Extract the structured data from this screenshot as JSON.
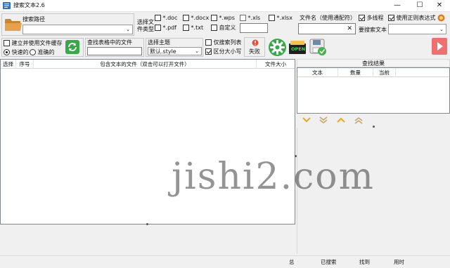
{
  "window": {
    "title": "搜索文本2.6",
    "controls": [
      "—",
      "☐",
      "✕"
    ]
  },
  "search_path": {
    "label": "搜索路径",
    "value": ""
  },
  "file_types": {
    "label_line1": "选择文",
    "label_line2": "件类型",
    "items": [
      {
        "label": "*.doc",
        "checked": false
      },
      {
        "label": "*.docx",
        "checked": false
      },
      {
        "label": "*.wps",
        "checked": false
      },
      {
        "label": "*.xls",
        "checked": false
      },
      {
        "label": "*.xlsx",
        "checked": false
      },
      {
        "label": "*.pdf",
        "checked": false
      },
      {
        "label": "*.txt",
        "checked": false
      },
      {
        "label": "自定义",
        "checked": false
      }
    ],
    "custom_value": ""
  },
  "file_name": {
    "label": "文件名（使用通配符）",
    "value": "",
    "clear_glyph": "✕"
  },
  "options": {
    "multithread": {
      "label": "多线程",
      "checked": true
    },
    "regex": {
      "label": "使用正则表达式",
      "checked": true
    },
    "search_text_label": "要搜索文本",
    "search_text_value": ""
  },
  "cache": {
    "label": "建立并使用文件缓存",
    "checked": false,
    "fast": "快速的",
    "accurate": "准确的",
    "selected": "fast"
  },
  "table_search": {
    "label": "查找表格中的文件",
    "value": ""
  },
  "theme": {
    "label": "选择主题",
    "value": "默认.style"
  },
  "flags": {
    "search_list_only": {
      "label": "仅搜索列表",
      "checked": false
    },
    "case_sensitive": {
      "label": "区分大小写",
      "checked": true
    }
  },
  "toolbar": {
    "fail_label": "失败",
    "open_label": "OPEN"
  },
  "file_table": {
    "columns": [
      "选择",
      "序号",
      "包含文本的文件（双击可以打开文件）",
      "文件大小"
    ],
    "rows": []
  },
  "results": {
    "title": "查找结果",
    "columns": [
      "文本",
      "数量",
      "当前"
    ],
    "rows": []
  },
  "status": {
    "total": "总",
    "searched": "已搜索",
    "found": "找到",
    "elapsed": "用时"
  },
  "watermark": "jishi2.com",
  "colors": {
    "accent_green": "#3aa84a",
    "play_red": "#f07070",
    "nav_orange": "#f5a623",
    "folder_orange": "#e8a04a"
  }
}
